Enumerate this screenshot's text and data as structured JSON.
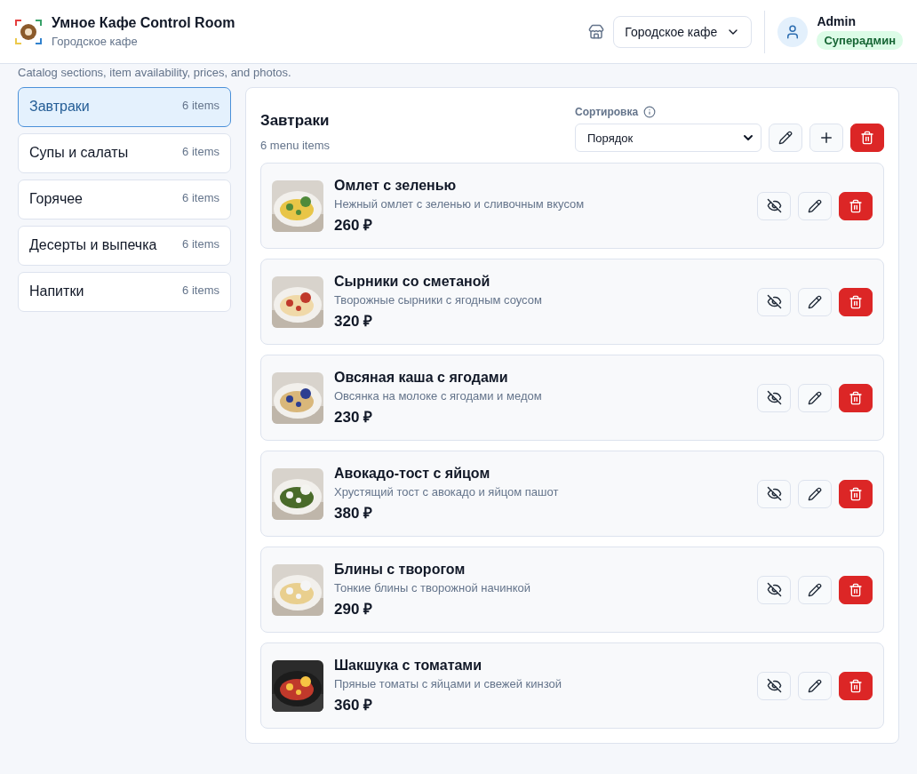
{
  "header": {
    "title": "Умное Кафе Control Room",
    "subtitle": "Городское кафе",
    "cafe_select": {
      "value": "Городское кафе"
    },
    "user": {
      "name": "Admin",
      "role": "Суперадмин"
    }
  },
  "page_description": "Catalog sections, item availability, prices, and photos.",
  "sidebar": {
    "items": [
      {
        "label": "Завтраки",
        "count": "6 items",
        "selected": true
      },
      {
        "label": "Супы и салаты",
        "count": "6 items",
        "selected": false
      },
      {
        "label": "Горячее",
        "count": "6 items",
        "selected": false
      },
      {
        "label": "Десерты и выпечка",
        "count": "6 items",
        "selected": false
      },
      {
        "label": "Напитки",
        "count": "6 items",
        "selected": false
      }
    ]
  },
  "section": {
    "title": "Завтраки",
    "count": "6 menu items",
    "sort_label": "Сортировка",
    "sort_value": "Порядок",
    "items": [
      {
        "name": "Омлет с зеленью",
        "description": "Нежный омлет с зеленью и сливочным вкусом",
        "price": "260 ₽",
        "hidden": false
      },
      {
        "name": "Сырники со сметаной",
        "description": "Творожные сырники с ягодным соусом",
        "price": "320 ₽",
        "hidden": false
      },
      {
        "name": "Овсяная каша с ягодами",
        "description": "Овсянка на молоке с ягодами и медом",
        "price": "230 ₽",
        "hidden": false
      },
      {
        "name": "Авокадо-тост с яйцом",
        "description": "Хрустящий тост с авокадо и яйцом пашот",
        "price": "380 ₽",
        "hidden": false
      },
      {
        "name": "Блины с творогом",
        "description": "Тонкие блины с творожной начинкой",
        "price": "290 ₽",
        "hidden": false
      },
      {
        "name": "Шакшука с томатами",
        "description": "Пряные томаты с яйцами и свежей кинзой",
        "price": "360 ₽",
        "hidden": false
      }
    ]
  }
}
